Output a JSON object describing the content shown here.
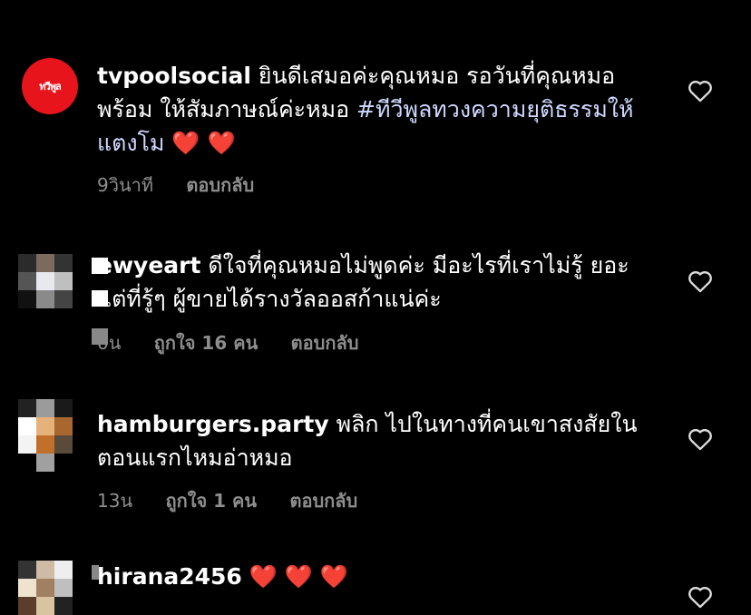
{
  "comments": [
    {
      "username": "tvpoolsocial",
      "text": " ยินดีเสมอค่ะคุณหมอ รอวันที่คุณหมอพร้อม ให้สัมภาษณ์ค่ะหมอ ",
      "hashtag": "#ทีวีพูลทวงความยุติธรรมให้แตงโม",
      "emoji": " ❤️ ❤️",
      "time": "9วินาที",
      "reply": "ตอบกลับ"
    },
    {
      "username": "ewyeart",
      "text": " ดีใจที่คุณหมอไม่พูดค่ะ มีอะไรที่เราไม่รู้ ยอะ แต่ที่รู้ๆ ผู้ขายได้รางวัลออสก้าแน่ค่ะ",
      "time": "0น",
      "likes": "ถูกใจ 16 คน",
      "reply": "ตอบกลับ"
    },
    {
      "username": "hamburgers.party",
      "text": " พลิก ไปในทางที่คนเขาสงสัยในตอนแรกไหมอ่าหมอ",
      "time": "13น",
      "likes": "ถูกใจ 1 คน",
      "reply": "ตอบกลับ"
    },
    {
      "username": "hirana2456",
      "emoji": " ❤️ ❤️ ❤️"
    }
  ],
  "icons": {
    "like": "heart-outline-icon"
  }
}
